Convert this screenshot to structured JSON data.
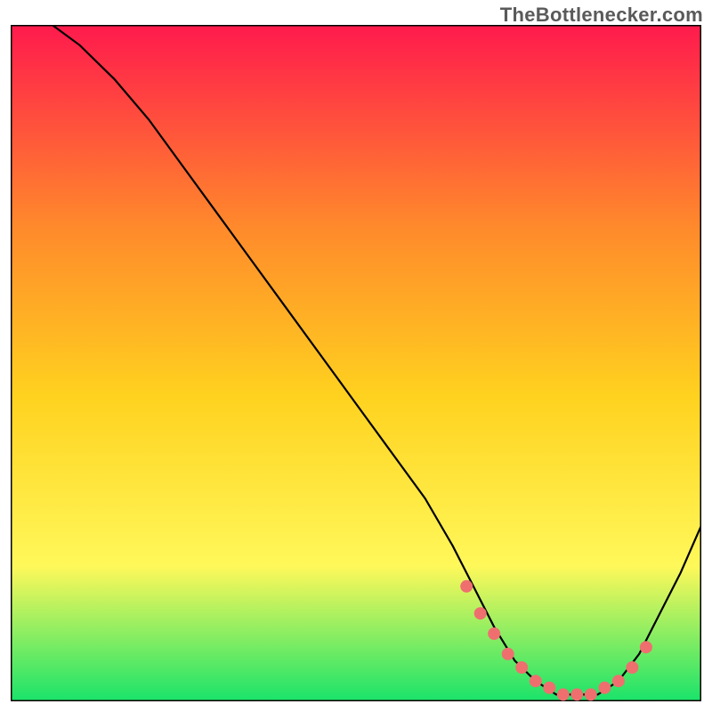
{
  "attribution": "TheBottlenecker.com",
  "chart_data": {
    "type": "line",
    "title": "",
    "xlabel": "",
    "ylabel": "",
    "xlim": [
      0,
      100
    ],
    "ylim": [
      0,
      100
    ],
    "grid": false,
    "legend": false,
    "background_gradient": {
      "top": "#ff1a4d",
      "mid_upper": "#ff8a2b",
      "mid": "#ffd21f",
      "mid_lower": "#fff85a",
      "bottom": "#19e36a"
    },
    "series": [
      {
        "name": "bottleneck-curve",
        "color": "#000000",
        "x": [
          6,
          10,
          15,
          20,
          25,
          30,
          35,
          40,
          45,
          50,
          55,
          60,
          64,
          67,
          70,
          73,
          76,
          79,
          82,
          85,
          88,
          91,
          94,
          97,
          100
        ],
        "y": [
          100,
          97,
          92,
          86,
          79,
          72,
          65,
          58,
          51,
          44,
          37,
          30,
          23,
          17,
          11,
          6,
          3,
          1,
          1,
          1,
          3,
          7,
          13,
          19,
          26
        ]
      }
    ],
    "highlight": {
      "name": "optimal-range-dots",
      "color": "#ef6f6f",
      "x": [
        66,
        68,
        70,
        72,
        74,
        76,
        78,
        80,
        82,
        84,
        86,
        88,
        90,
        92
      ],
      "y": [
        17,
        13,
        10,
        7,
        5,
        3,
        2,
        1,
        1,
        1,
        2,
        3,
        5,
        8
      ]
    }
  }
}
